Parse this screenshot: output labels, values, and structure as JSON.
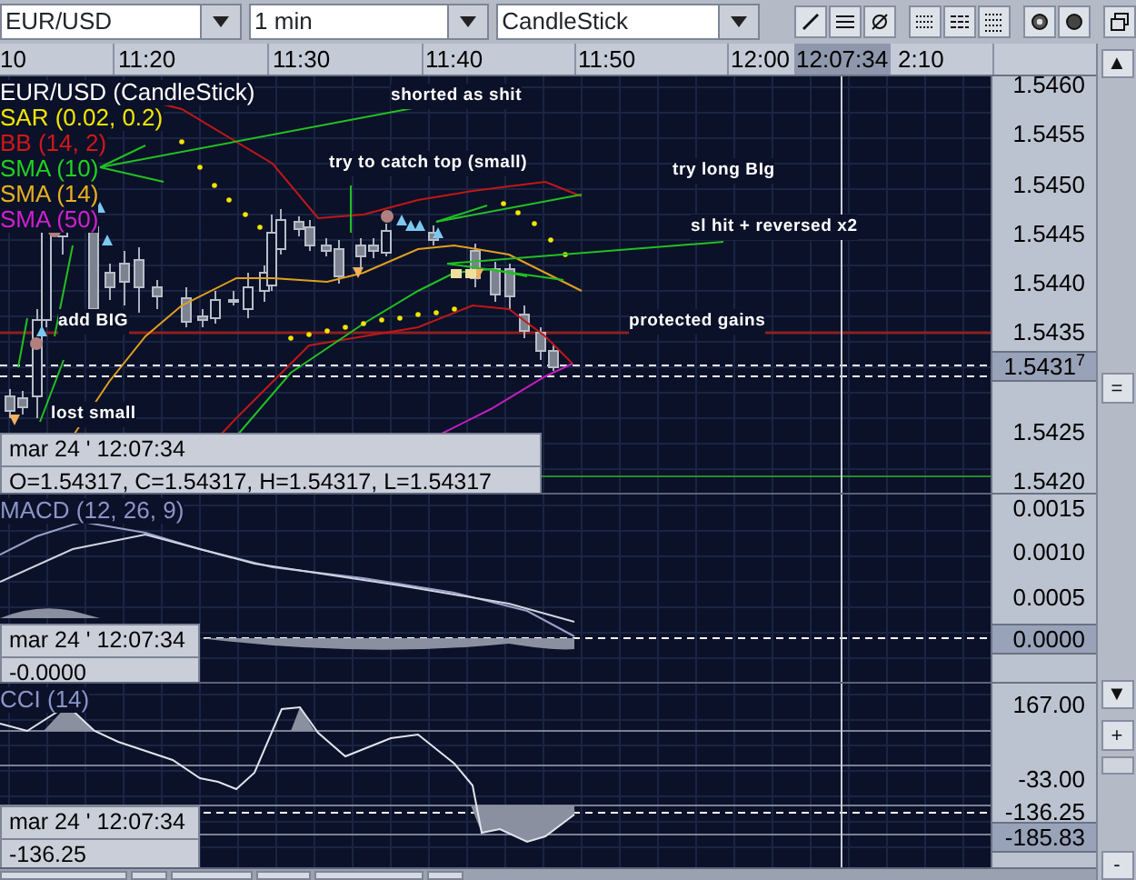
{
  "toolbar": {
    "symbol": "EUR/USD",
    "interval": "1 min",
    "chart_type": "CandleStick"
  },
  "time_axis": {
    "labels": [
      "10",
      "11:20",
      "11:30",
      "11:40",
      "11:50",
      "12:00"
    ],
    "cursor_time": "12:07:34",
    "trailing_label": "2:10"
  },
  "price_panel": {
    "legend": [
      {
        "text": "EUR/USD (CandleStick)",
        "color": "#ffffff"
      },
      {
        "text": "SAR (0.02, 0.2)",
        "color": "#f2e600"
      },
      {
        "text": "BB (14, 2)",
        "color": "#d01818"
      },
      {
        "text": "SMA (10)",
        "color": "#22d022"
      },
      {
        "text": "SMA (14)",
        "color": "#e8b020"
      },
      {
        "text": "SMA (50)",
        "color": "#d020d0"
      }
    ],
    "annotations": [
      "shorted as shit",
      "try to catch top (small)",
      "try long BIg",
      "sl hit + reversed x2",
      "add BIG",
      "protected gains",
      "lost small"
    ],
    "axis_labels": [
      "1.5460",
      "1.5455",
      "1.5450",
      "1.5445",
      "1.5440",
      "1.5435",
      "1.5425",
      "1.5420"
    ],
    "current_price": "1.5431$^{7}$",
    "info": {
      "date": "mar 24 ' 12:07:34",
      "values": "O=1.54317, C=1.54317, H=1.54317, L=1.54317"
    }
  },
  "macd_panel": {
    "legend": "MACD (12, 26, 9)",
    "axis_labels": [
      "0.0015",
      "0.0010",
      "0.0005"
    ],
    "current_value": "0.0000",
    "info": {
      "date": "mar 24 ' 12:07:34",
      "values": "-0.0000"
    }
  },
  "cci_panel": {
    "legend": "CCI (14)",
    "axis_labels": [
      "167.00",
      "-33.00",
      "-136.25"
    ],
    "current_value": "-185.83",
    "info": {
      "date": "mar 24 ' 12:07:34",
      "values": "-136.25"
    }
  },
  "scrollbar": {
    "buttons": [
      "▲",
      "=",
      "▼",
      "+",
      "-"
    ]
  }
}
